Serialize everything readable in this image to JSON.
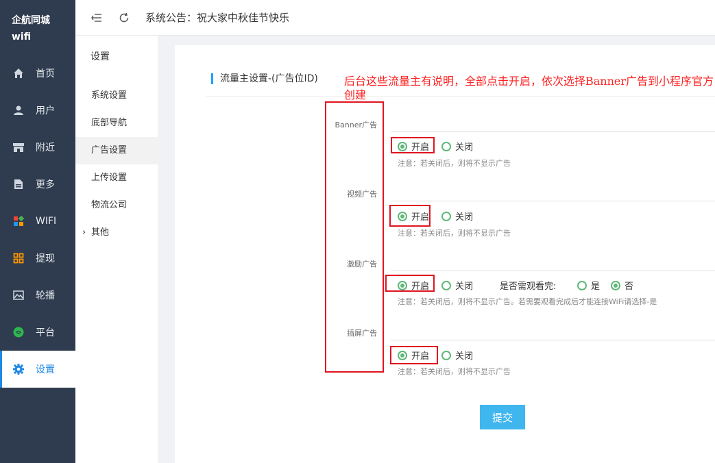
{
  "nav": {
    "brand": "企航同城\nwifi",
    "items": [
      {
        "label": "首页",
        "icon": "home-icon"
      },
      {
        "label": "用户",
        "icon": "user-icon"
      },
      {
        "label": "附近",
        "icon": "store-icon"
      },
      {
        "label": "更多",
        "icon": "document-icon"
      },
      {
        "label": "WIFI",
        "icon": "apps-icon"
      },
      {
        "label": "提现",
        "icon": "grid-icon"
      },
      {
        "label": "轮播",
        "icon": "image-icon"
      },
      {
        "label": "平台",
        "icon": "wechat-icon"
      },
      {
        "label": "设置",
        "icon": "gear-icon"
      }
    ],
    "active_index": 8
  },
  "topbar": {
    "notice": "系统公告：祝大家中秋佳节快乐"
  },
  "subnav": {
    "title": "设置",
    "items": [
      "系统设置",
      "底部导航",
      "广告设置",
      "上传设置",
      "物流公司",
      "其他"
    ],
    "active": "广告设置"
  },
  "form": {
    "section_title": "流量主设置-(广告位ID)",
    "fields": [
      {
        "label": "Banner广告",
        "on_label": "开启",
        "off_label": "关闭",
        "value": "开启",
        "hint": "注意：若关闭后，则将不显示广告"
      },
      {
        "label": "视频广告",
        "on_label": "开启",
        "off_label": "关闭",
        "value": "开启",
        "hint": "注意：若关闭后，则将不显示广告"
      },
      {
        "label": "激励广告",
        "on_label": "开启",
        "off_label": "关闭",
        "value": "开启",
        "extra_label": "是否需观看完:",
        "yes_label": "是",
        "no_label": "否",
        "extra_value": "否",
        "hint": "注意：若关闭后，则将不显示广告。若需要观看完成后才能连接WiFi请选择-是"
      },
      {
        "label": "插屏广告",
        "on_label": "开启",
        "off_label": "关闭",
        "value": "开启",
        "hint": "注意：若关闭后，则将不显示广告"
      }
    ],
    "submit_label": "提交"
  },
  "annotation": {
    "text": "后台这些流量主有说明，全部点击开启，依次选择Banner广告到小程序官方创建"
  },
  "colors": {
    "nav_bg": "#2f3c4f",
    "accent": "#1e9fff",
    "radio": "#5fb878",
    "annotation": "#e0131f"
  }
}
